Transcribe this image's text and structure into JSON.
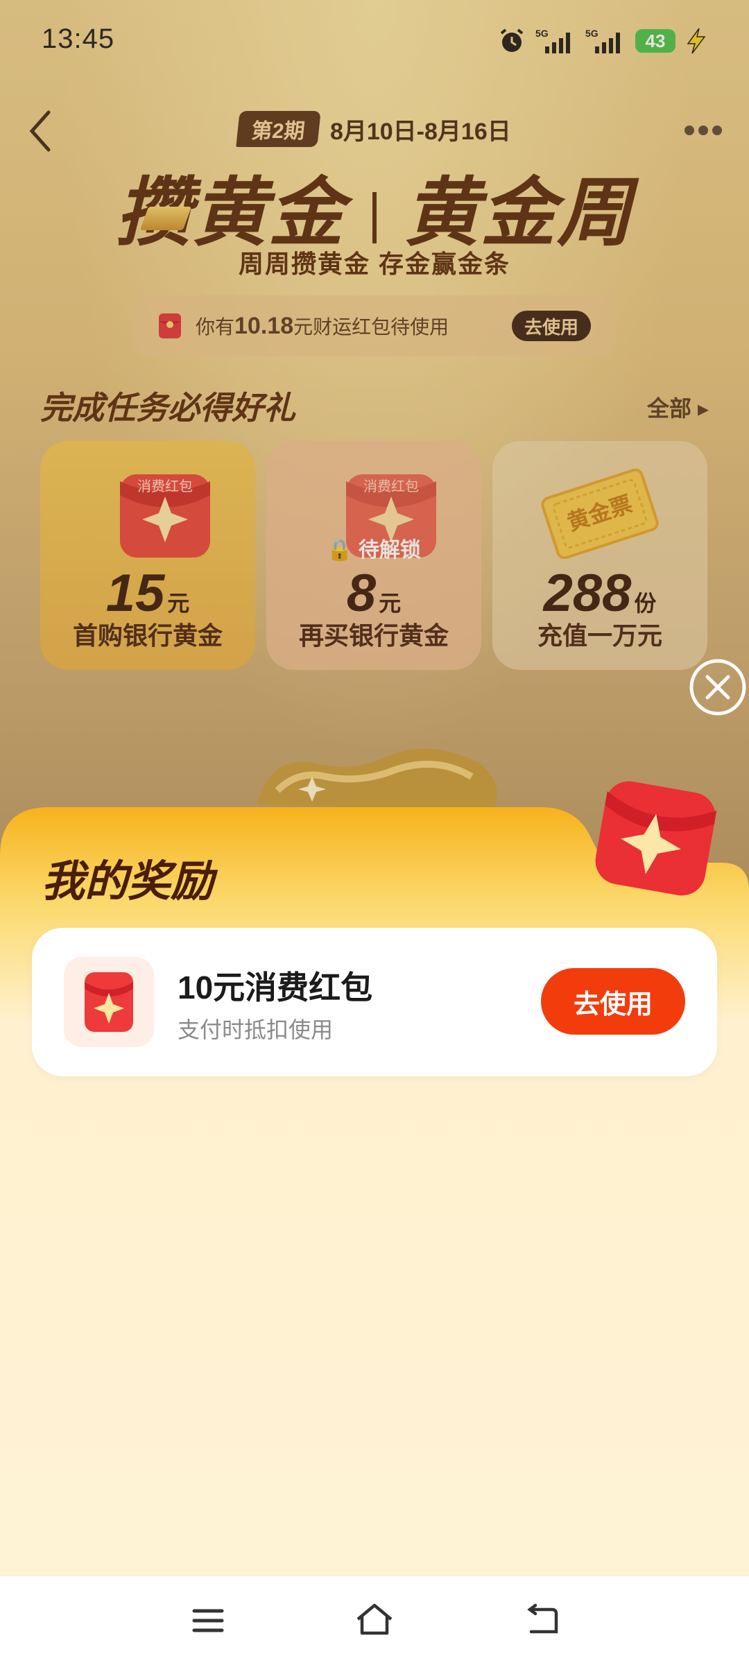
{
  "status_bar": {
    "time": "13:45",
    "network_1": "5G",
    "network_2": "5G",
    "battery": "43",
    "icons": [
      "alarm-icon",
      "signal-icon",
      "signal-icon",
      "battery-icon",
      "charging-bolt-icon"
    ]
  },
  "header": {
    "period_badge": "第2期",
    "period_dates": "8月10日-8月16日",
    "title_left": "攒黄金",
    "title_right": "黄金周",
    "subtitle": "周周攒黄金 存金赢金条"
  },
  "wallet": {
    "prefix": "你有",
    "amount": "10.18",
    "suffix": "元财运红包待使用",
    "button": "去使用"
  },
  "tasks_section": {
    "title": "完成任务必得好礼",
    "more": "全部"
  },
  "tasks": [
    {
      "badge": "消费红包",
      "amount": "15",
      "unit": "元",
      "label": "首购银行黄金"
    },
    {
      "badge": "消费红包",
      "lock": "待解锁",
      "amount": "8",
      "unit": "元",
      "label": "再买银行黄金"
    },
    {
      "badge": "黄金票",
      "amount": "288",
      "unit": "份",
      "label": "充值一万元"
    }
  ],
  "sheet": {
    "title": "我的奖励",
    "reward": {
      "name": "10元消费红包",
      "desc": "支付时抵扣使用",
      "button": "去使用"
    }
  },
  "colors": {
    "accent": "#f23c0c",
    "title_brown": "#5a2a0c",
    "sheet_top": "#f7b524",
    "sheet_bottom": "#fff3d6"
  }
}
